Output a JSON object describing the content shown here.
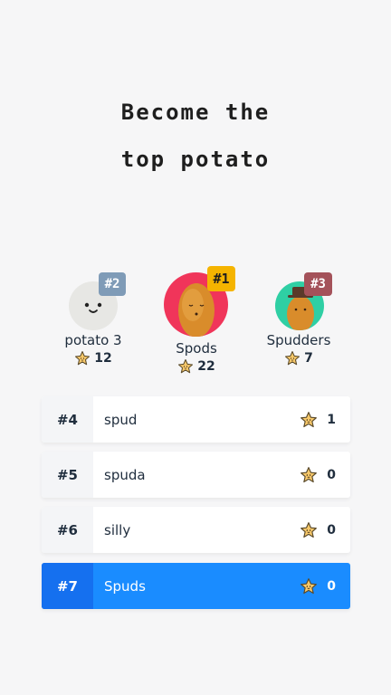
{
  "title": {
    "line1": "Become the",
    "line2": "top potato"
  },
  "podium": [
    {
      "rank": "#1",
      "name": "Spods",
      "score": "22",
      "badge_color": "#f5b400",
      "ring_color": "#f0355a"
    },
    {
      "rank": "#2",
      "name": "potato 3",
      "score": "12",
      "badge_color": "#7f9bb7",
      "ring_color": "#e7e7e4"
    },
    {
      "rank": "#3",
      "name": "Spudders",
      "score": "7",
      "badge_color": "#a4525a",
      "ring_color": "#2fcfa4"
    }
  ],
  "list": [
    {
      "rank": "#4",
      "name": "spud",
      "score": "1"
    },
    {
      "rank": "#5",
      "name": "spuda",
      "score": "0"
    },
    {
      "rank": "#6",
      "name": "silly",
      "score": "0"
    },
    {
      "rank": "#7",
      "name": "Spuds",
      "score": "0",
      "current_user": true
    }
  ],
  "colors": {
    "accent": "#1a8cff",
    "star": "#f8c96a"
  }
}
